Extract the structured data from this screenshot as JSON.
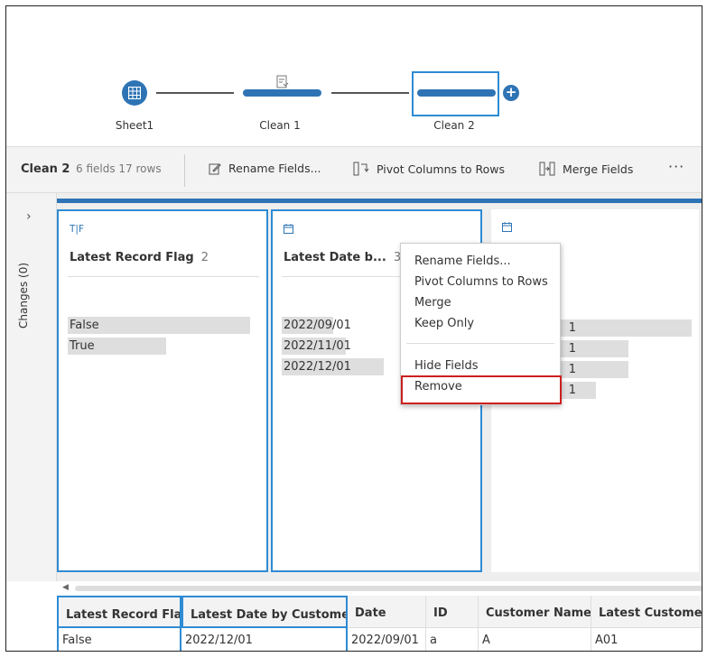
{
  "flow": {
    "nodes": [
      {
        "label": "Sheet1",
        "icon": "table-icon"
      },
      {
        "label": "Clean 1",
        "icon": "clean-doc-icon"
      },
      {
        "label": "Clean 2",
        "icon": "clean-step-icon"
      }
    ],
    "add_label": "+"
  },
  "toolbar": {
    "title": "Clean 2",
    "meta": "6 fields  17 rows",
    "rename_label": "Rename Fields...",
    "pivot_label": "Pivot Columns to Rows",
    "merge_label": "Merge Fields",
    "more_label": "···"
  },
  "side": {
    "chevron": "›",
    "changes_label": "Changes (0)"
  },
  "cards": [
    {
      "type_label": "T|F",
      "title": "Latest Record Flag",
      "count": "2",
      "values": [
        {
          "text": "False",
          "fill": 1.0
        },
        {
          "text": "True",
          "fill": 0.54
        }
      ]
    },
    {
      "type_label": "calendar-icon",
      "title": "Latest Date b...",
      "count": "3",
      "values": [
        {
          "text": "2022/09/01",
          "fill": 0.28
        },
        {
          "text": "2022/11/01",
          "fill": 0.35
        },
        {
          "text": "2022/12/01",
          "fill": 0.56
        }
      ]
    },
    {
      "type_label": "calendar-icon",
      "title": "",
      "count": "",
      "values": [
        {
          "text": "1",
          "fill": 1.0
        },
        {
          "text": "1",
          "fill": 0.67
        },
        {
          "text": "1",
          "fill": 0.67
        },
        {
          "text": "1",
          "fill": 0.5
        }
      ]
    }
  ],
  "menu": {
    "items": [
      "Rename Fields...",
      "Pivot Columns to Rows",
      "Merge",
      "Keep Only",
      "Hide Fields",
      "Remove"
    ]
  },
  "grid": {
    "headers": [
      "Latest Record Flag",
      "Latest Date by Customer",
      "Date",
      "ID",
      "Customer Name",
      "Latest Customer I"
    ],
    "row": [
      "False",
      "2022/12/01",
      "2022/09/01",
      "a",
      "A",
      "A01"
    ]
  },
  "colors": {
    "accent": "#2e74b5",
    "selection": "#2e8bd4",
    "highlight": "#cc1f1f"
  }
}
